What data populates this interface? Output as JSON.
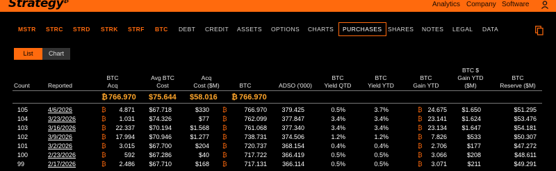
{
  "brand": {
    "name": "Strategy",
    "mark": "₿"
  },
  "top_nav": [
    "Analytics",
    "Company",
    "Software"
  ],
  "subnav": {
    "tickers": [
      "MSTR",
      "STRC",
      "STRD",
      "STRK",
      "STRF",
      "BTC"
    ],
    "items": [
      "DEBT",
      "CREDIT",
      "ASSETS",
      "OPTIONS",
      "CHARTS",
      "PURCHASES",
      "SHARES",
      "NOTES",
      "LEGAL",
      "DATA"
    ],
    "active": "PURCHASES"
  },
  "view_toggle": {
    "list": "List",
    "chart": "Chart"
  },
  "columns": {
    "count": "Count",
    "reported": "Reported",
    "btc_acq": [
      "BTC",
      "Acq"
    ],
    "avg_btc_cost": [
      "Avg BTC",
      "Cost"
    ],
    "acq_cost": [
      "Acq",
      "Cost ($M)"
    ],
    "btc": "BTC",
    "adso": "ADSO ('000)",
    "yield_qtd": [
      "BTC",
      "Yield QTD"
    ],
    "yield_ytd": [
      "BTC",
      "Yield YTD"
    ],
    "gain_ytd": [
      "BTC",
      "Gain YTD"
    ],
    "gain_usd_ytd": [
      "BTC $",
      "Gain YTD",
      "($M)"
    ],
    "reserve": [
      "BTC",
      "Reserve ($M)"
    ]
  },
  "summary": {
    "btc_acq": "766.970",
    "avg_cost": "$75.644",
    "acq_cost": "$58.016",
    "btc": "766.970",
    "btc_symbol": "₿"
  },
  "rows": [
    {
      "count": "105",
      "reported": "4/6/2026",
      "btc_acq": "4.871",
      "avg_cost": "$67.718",
      "acq_cost": "$330",
      "btc": "766.970",
      "adso": "379.425",
      "yqtd": "0.5%",
      "yytd": "3.7%",
      "gain_ytd": "24.675",
      "gain_usd": "$1.650",
      "reserve": "$51.295"
    },
    {
      "count": "104",
      "reported": "3/23/2026",
      "btc_acq": "1.031",
      "avg_cost": "$74.326",
      "acq_cost": "$77",
      "btc": "762.099",
      "adso": "377.847",
      "yqtd": "3.4%",
      "yytd": "3.4%",
      "gain_ytd": "23.141",
      "gain_usd": "$1.624",
      "reserve": "$53.476"
    },
    {
      "count": "103",
      "reported": "3/16/2026",
      "btc_acq": "22.337",
      "avg_cost": "$70.194",
      "acq_cost": "$1.568",
      "btc": "761.068",
      "adso": "377.340",
      "yqtd": "3.4%",
      "yytd": "3.4%",
      "gain_ytd": "23.134",
      "gain_usd": "$1.647",
      "reserve": "$54.181"
    },
    {
      "count": "102",
      "reported": "3/9/2026",
      "btc_acq": "17.994",
      "avg_cost": "$70.946",
      "acq_cost": "$1.277",
      "btc": "738.731",
      "adso": "374.506",
      "yqtd": "1.2%",
      "yytd": "1.2%",
      "gain_ytd": "7.826",
      "gain_usd": "$533",
      "reserve": "$50.307"
    },
    {
      "count": "101",
      "reported": "3/2/2026",
      "btc_acq": "3.015",
      "avg_cost": "$67.700",
      "acq_cost": "$204",
      "btc": "720.737",
      "adso": "368.154",
      "yqtd": "0.4%",
      "yytd": "0.4%",
      "gain_ytd": "2.706",
      "gain_usd": "$177",
      "reserve": "$47.272"
    },
    {
      "count": "100",
      "reported": "2/23/2026",
      "btc_acq": "592",
      "avg_cost": "$67.286",
      "acq_cost": "$40",
      "btc": "717.722",
      "adso": "366.419",
      "yqtd": "0.5%",
      "yytd": "0.5%",
      "gain_ytd": "3.066",
      "gain_usd": "$208",
      "reserve": "$48.611"
    },
    {
      "count": "99",
      "reported": "2/17/2026",
      "btc_acq": "2.486",
      "avg_cost": "$67.710",
      "acq_cost": "$168",
      "btc": "717.131",
      "adso": "366.114",
      "yqtd": "0.5%",
      "yytd": "0.5%",
      "gain_ytd": "3.071",
      "gain_usd": "$211",
      "reserve": "$49.291"
    }
  ],
  "colors": {
    "accent": "#ff6a0d",
    "summary": "#ffa62b",
    "background": "#000000"
  }
}
